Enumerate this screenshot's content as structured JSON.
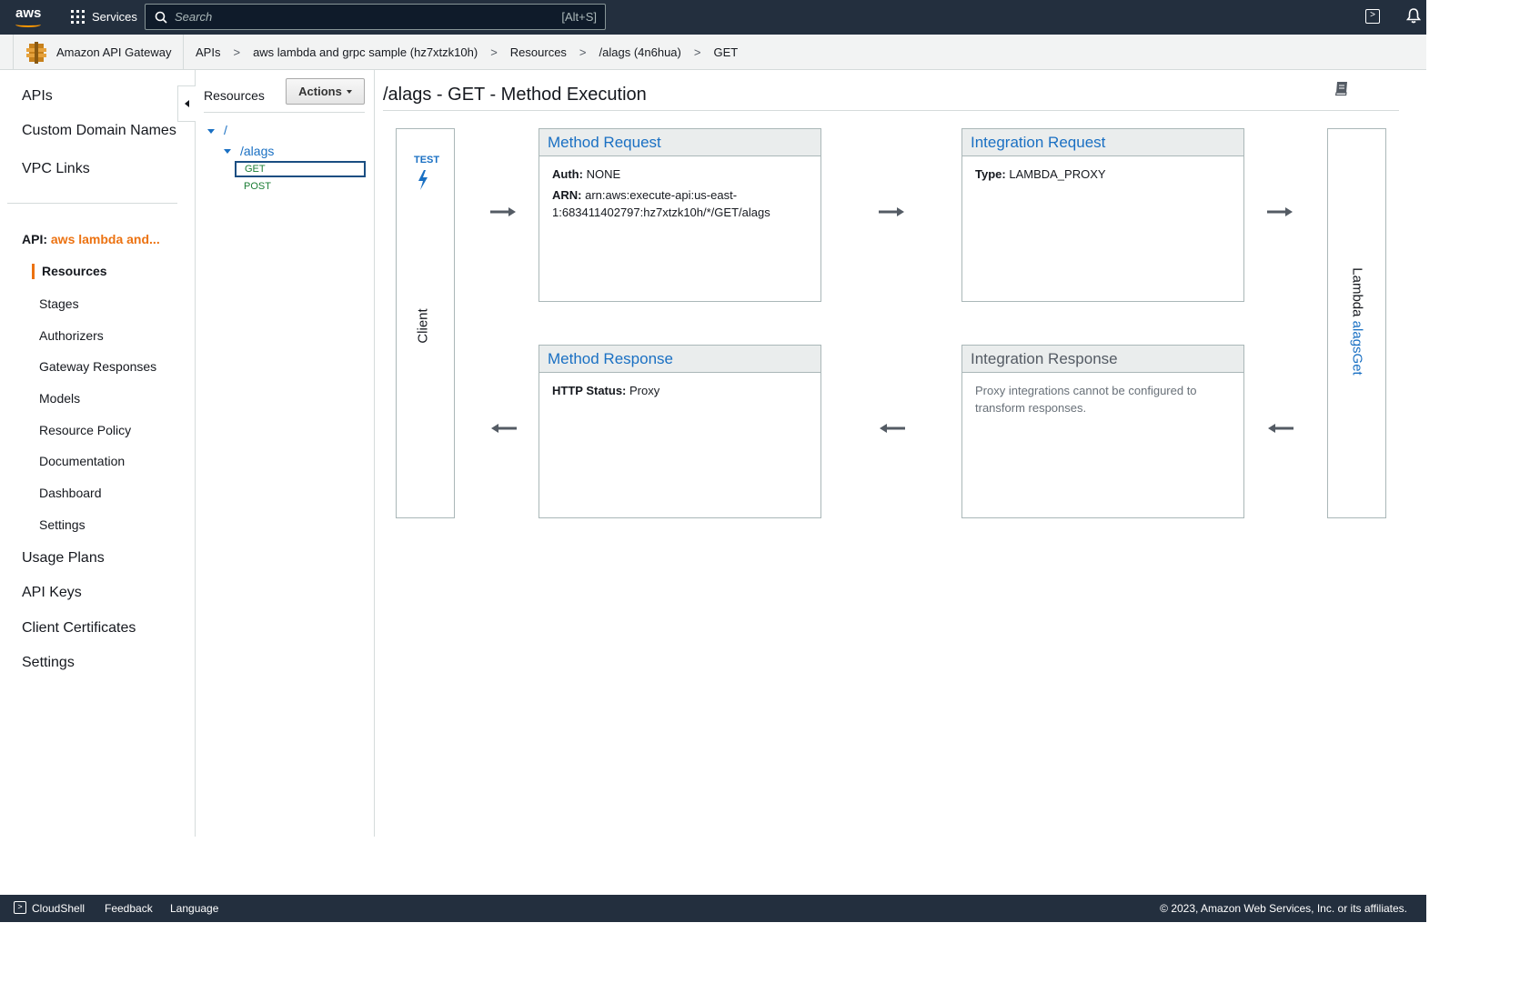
{
  "topnav": {
    "logo_text": "aws",
    "services_label": "Services",
    "search_placeholder": "Search",
    "search_shortcut": "[Alt+S]"
  },
  "breadcrumb": {
    "service_name": "Amazon API Gateway",
    "items": [
      "APIs",
      "aws lambda and grpc sample (hz7xtzk10h)",
      "Resources",
      "/alags (4n6hua)",
      "GET"
    ],
    "separator": ">"
  },
  "leftnav": {
    "top_items": [
      "APIs",
      "Custom Domain Names",
      "VPC Links"
    ],
    "api_prefix": "API:",
    "api_name": "aws lambda and...",
    "active_item": "Resources",
    "sub_items": [
      "Stages",
      "Authorizers",
      "Gateway Responses",
      "Models",
      "Resource Policy",
      "Documentation",
      "Dashboard",
      "Settings"
    ],
    "bottom_items": [
      "Usage Plans",
      "API Keys",
      "Client Certificates",
      "Settings"
    ]
  },
  "resources": {
    "title": "Resources",
    "actions_label": "Actions",
    "root": "/",
    "child": "/alags",
    "methods": [
      "GET",
      "POST"
    ]
  },
  "main": {
    "title": "/alags - GET - Method Execution",
    "client": {
      "test_label": "TEST",
      "label": "Client"
    },
    "lambda": {
      "prefix": "Lambda",
      "function": "alagsGet"
    },
    "method_request": {
      "title": "Method Request",
      "auth_key": "Auth:",
      "auth_val": "NONE",
      "arn_key": "ARN:",
      "arn_val": "arn:aws:execute-api:us-east-1:683411402797:hz7xtzk10h/*/GET/alags"
    },
    "integration_request": {
      "title": "Integration Request",
      "type_key": "Type:",
      "type_val": "LAMBDA_PROXY"
    },
    "method_response": {
      "title": "Method Response",
      "status_key": "HTTP Status:",
      "status_val": "Proxy"
    },
    "integration_response": {
      "title": "Integration Response",
      "message": "Proxy integrations cannot be configured to transform responses."
    }
  },
  "footer": {
    "cloudshell": "CloudShell",
    "feedback": "Feedback",
    "language": "Language",
    "copyright": "© 2023, Amazon Web Services, Inc. or its affiliates."
  },
  "colors": {
    "nav_bg": "#232f3e",
    "accent_orange": "#ec7211",
    "link_blue": "#1a70c3",
    "method_green": "#1a7c34"
  }
}
